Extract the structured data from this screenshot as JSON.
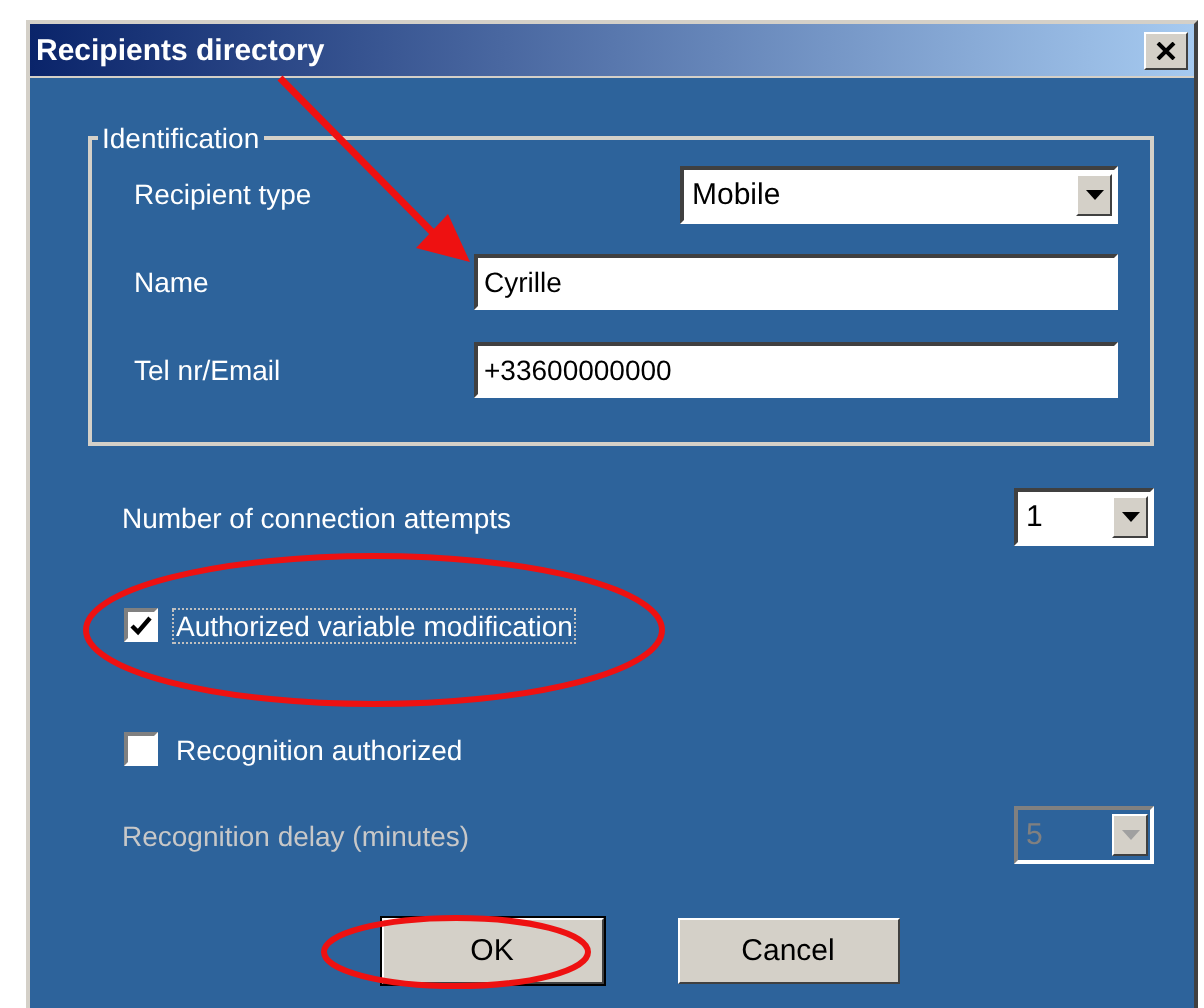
{
  "window": {
    "title": "Recipients directory"
  },
  "identification": {
    "title": "Identification",
    "fields": [
      {
        "kind": "select",
        "label": "Recipient type",
        "value": "Mobile"
      },
      {
        "kind": "text",
        "label": "Name",
        "value": "Cyrille"
      },
      {
        "kind": "text",
        "label": "Tel nr/Email",
        "value": "+33600000000"
      }
    ]
  },
  "settings": [
    {
      "kind": "select",
      "label": "Number of connection attempts",
      "value": "1",
      "disabled": false
    },
    {
      "kind": "checkbox",
      "label": "Authorized variable modification",
      "checked": true,
      "focused": true
    },
    {
      "kind": "checkbox",
      "label": "Recognition authorized",
      "checked": false,
      "focused": false
    },
    {
      "kind": "select",
      "label": "Recognition delay (minutes)",
      "value": "5",
      "disabled": true
    }
  ],
  "buttons": [
    {
      "label": "OK",
      "default": true
    },
    {
      "label": "Cancel",
      "default": false
    }
  ]
}
